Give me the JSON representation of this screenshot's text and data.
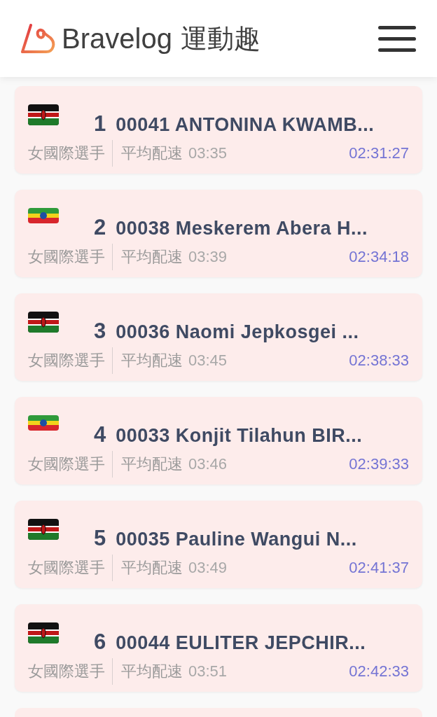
{
  "header": {
    "logo_text": "Bravelog",
    "logo_cjk": "運動趣"
  },
  "runners": [
    {
      "kind": "kenya",
      "rank": "1",
      "name": "00041 ANTONINA KWAMB...",
      "category": "女國際選手",
      "pace_label": "平均配速",
      "pace": "03:35",
      "time": "02:31:27"
    },
    {
      "kind": "ethiopia",
      "rank": "2",
      "name": "00038 Meskerem Abera H...",
      "category": "女國際選手",
      "pace_label": "平均配速",
      "pace": "03:39",
      "time": "02:34:18"
    },
    {
      "kind": "kenya",
      "rank": "3",
      "name": "00036 Naomi Jepkosgei ...",
      "category": "女國際選手",
      "pace_label": "平均配速",
      "pace": "03:45",
      "time": "02:38:33"
    },
    {
      "kind": "ethiopia",
      "rank": "4",
      "name": "00033 Konjit Tilahun BIR...",
      "category": "女國際選手",
      "pace_label": "平均配速",
      "pace": "03:46",
      "time": "02:39:33"
    },
    {
      "kind": "kenya",
      "rank": "5",
      "name": "00035 Pauline Wangui N...",
      "category": "女國際選手",
      "pace_label": "平均配速",
      "pace": "03:49",
      "time": "02:41:37"
    },
    {
      "kind": "kenya",
      "rank": "6",
      "name": "00044 EULITER JEPCHIR...",
      "category": "女國際選手",
      "pace_label": "平均配速",
      "pace": "03:51",
      "time": "02:42:33"
    }
  ]
}
